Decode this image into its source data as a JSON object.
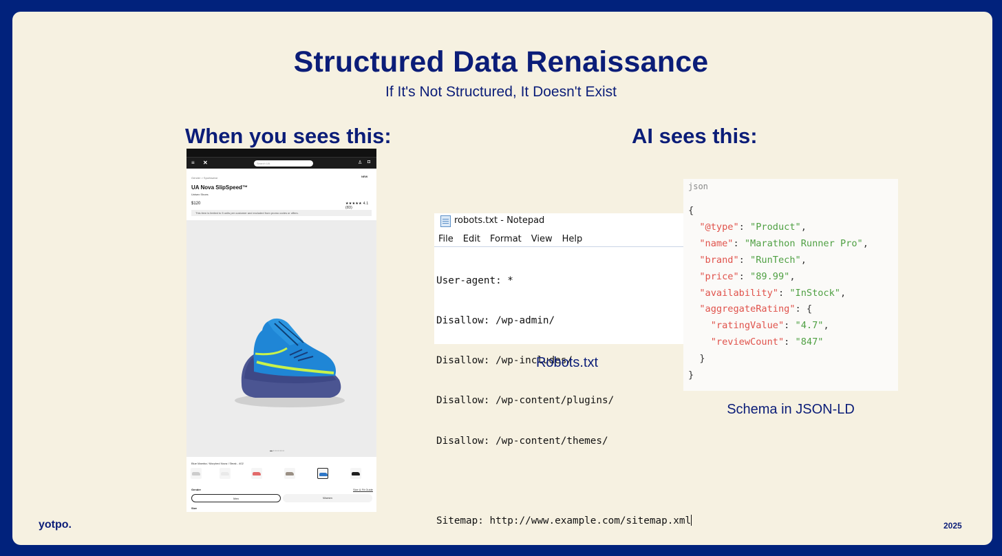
{
  "slide": {
    "title": "Structured Data Renaissance",
    "subtitle": "If It's Not Structured, It Doesn't Exist",
    "left_heading": "When you sees this:",
    "right_heading": "AI sees this:",
    "brand": "yotpo.",
    "year": "2025"
  },
  "product_page": {
    "search_placeholder": "Search UA",
    "breadcrumb": "Gender  >  Sportswear",
    "badge": "NEW",
    "product_name": "UA Nova SlipSpeed™",
    "product_sub": "Unisex Shoes",
    "price": "$120",
    "rating_text": "★★★★★ 4.1 (83)",
    "banner": "This item is limited to 5 units per customer and excluded from promo codes or offers.",
    "color_label": "Blue Mamba / Morphed Nova / Steak - 402",
    "gender_label": "Gender",
    "size_guide": "Size & Fit Guide",
    "options": [
      "Men",
      "Women"
    ],
    "size_label": "Size",
    "shoe_colors": [
      "#1f86d6",
      "#3f4a88",
      "#c8f24b"
    ],
    "thumb_colors": [
      "#cccccc",
      "#e9e9e9",
      "#e26a6a",
      "#9a8f84",
      "#2f77c7",
      "#1e1e1e"
    ]
  },
  "notepad": {
    "window_title": "robots.txt - Notepad",
    "menu": [
      "File",
      "Edit",
      "Format",
      "View",
      "Help"
    ],
    "lines": [
      "User-agent: *",
      "Disallow: /wp-admin/",
      "Disallow: /wp-includes/",
      "Disallow: /wp-content/plugins/",
      "Disallow: /wp-content/themes/",
      "",
      "Sitemap: http://www.example.com/sitemap.xml"
    ],
    "caption": "Robots.txt"
  },
  "json_snippet": {
    "lang": "json",
    "caption": "Schema in JSON-LD",
    "open": "{",
    "close": "}",
    "fields": [
      {
        "key": "\"@type\"",
        "value": "\"Product\""
      },
      {
        "key": "\"name\"",
        "value": "\"Marathon Runner Pro\""
      },
      {
        "key": "\"brand\"",
        "value": "\"RunTech\""
      },
      {
        "key": "\"price\"",
        "value": "\"89.99\""
      },
      {
        "key": "\"availability\"",
        "value": "\"InStock\""
      }
    ],
    "rating_key": "\"aggregateRating\"",
    "rating_fields": [
      {
        "key": "\"ratingValue\"",
        "value": "\"4.7\""
      },
      {
        "key": "\"reviewCount\"",
        "value": "\"847\""
      }
    ]
  },
  "colors": {
    "frame": "#01227c",
    "background": "#f6f1e1",
    "heading": "#0b1d78",
    "json_key": "#e0524b",
    "json_string": "#4fa043"
  }
}
